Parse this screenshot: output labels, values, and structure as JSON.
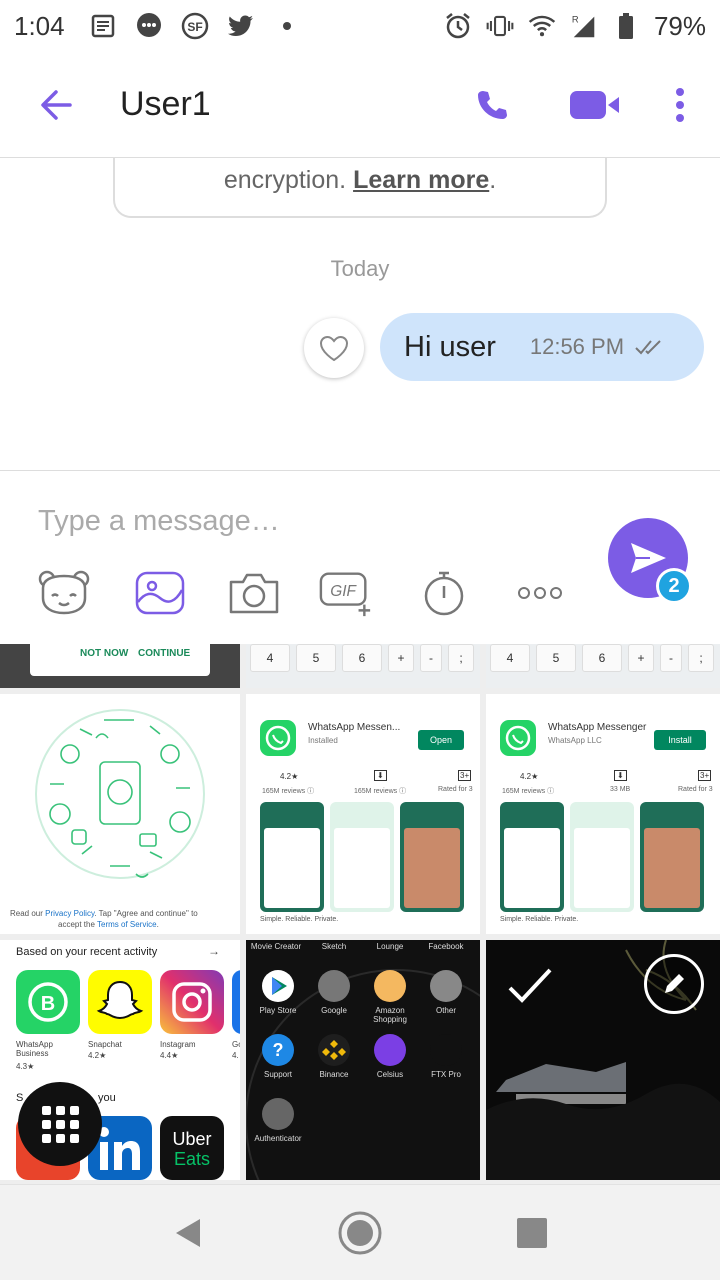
{
  "status_bar": {
    "time": "1:04",
    "battery": "79%",
    "left_icons": [
      "news-icon",
      "messages-icon",
      "sf-app-icon",
      "twitter-icon",
      "dot-icon"
    ],
    "right_icons": [
      "alarm-icon",
      "vibrate-icon",
      "wifi-icon",
      "signal-icon",
      "battery-icon"
    ]
  },
  "header": {
    "title": "User1",
    "accent": "#7c5ce5"
  },
  "chat": {
    "encryption_text": "encryption.",
    "encryption_link": "Learn more",
    "encryption_end": ".",
    "date_label": "Today",
    "messages": [
      {
        "text": "Hi user",
        "time": "12:56 PM",
        "status": "read"
      }
    ]
  },
  "composer": {
    "placeholder": "Type a message…",
    "send_badge": "2",
    "tools": [
      "sticker-icon",
      "gallery-icon",
      "camera-icon",
      "gif-icon",
      "timer-icon",
      "more-icon"
    ]
  },
  "gallery": {
    "t1": {
      "not_now": "NOT NOW",
      "continue": "CONTINUE"
    },
    "keys": [
      "4",
      "5",
      "6",
      "+",
      "-",
      ";"
    ],
    "t4": {
      "read_text": "Read our",
      "privacy": "Privacy Policy",
      "tap_text": ". Tap \"Agree and continue\" to",
      "accept_text": "accept the",
      "terms": "Terms of Service",
      "terms_end": "."
    },
    "t5": {
      "name": "WhatsApp Messen...",
      "sub": "Installed",
      "button": "Open",
      "rating": "4.2★",
      "reviews": "165M reviews ⓘ",
      "age": "3+",
      "age_sub": "Rated for 3",
      "tagline": "Simple. Reliable. Private."
    },
    "t6": {
      "name": "WhatsApp Messenger",
      "sub": "WhatsApp LLC",
      "button": "Install",
      "rating": "4.2★",
      "reviews": "165M reviews ⓘ",
      "size": "33 MB",
      "age": "3+",
      "age_sub": "Rated for 3",
      "tagline": "Simple. Reliable. Private."
    },
    "t7": {
      "heading": "Based on your recent activity",
      "apps": [
        {
          "name": "WhatsApp Business",
          "rating": "4.3★"
        },
        {
          "name": "Snapchat",
          "rating": "4.2★"
        },
        {
          "name": "Instagram",
          "rating": "4.4★"
        },
        {
          "name": "Go",
          "rating": "4."
        }
      ],
      "section2": "S",
      "section2_end": "you"
    },
    "t8": {
      "top_labels": [
        "Movie Creator",
        "Sketch",
        "Lounge",
        "Facebook"
      ],
      "apps": [
        "Play Store",
        "Google",
        "Amazon Shopping",
        "Other",
        "Support",
        "Binance",
        "Celsius",
        "FTX Pro",
        "Authenticator"
      ]
    }
  },
  "nav": {
    "back": "back-triangle-icon",
    "home": "home-circle-icon",
    "recents": "recents-square-icon"
  }
}
